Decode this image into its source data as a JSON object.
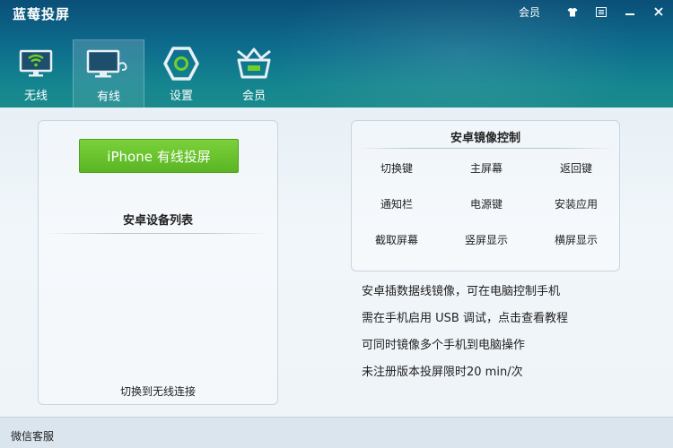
{
  "window": {
    "title": "蓝莓投屏",
    "member_label": "会员"
  },
  "tabs": [
    {
      "label": "无线",
      "icon": "wifi-monitor-icon"
    },
    {
      "label": "有线",
      "icon": "wired-monitor-icon",
      "active": true
    },
    {
      "label": "设置",
      "icon": "settings-hexagon-icon"
    },
    {
      "label": "会员",
      "icon": "crown-basket-icon"
    }
  ],
  "left": {
    "iphone_button": "iPhone 有线投屏",
    "device_list_title": "安卓设备列表",
    "switch_link": "切换到无线连接"
  },
  "mirror": {
    "title": "安卓镜像控制",
    "controls": [
      "切换键",
      "主屏幕",
      "返回键",
      "通知栏",
      "电源键",
      "安装应用",
      "截取屏幕",
      "竖屏显示",
      "横屏显示"
    ]
  },
  "tips": [
    "安卓插数据线镜像，可在电脑控制手机",
    "需在手机启用 USB 调试，点击查看教程",
    "可同时镜像多个手机到电脑操作",
    "未注册版本投屏限时20 min/次"
  ],
  "footer": {
    "wechat": "微信客服"
  },
  "colors": {
    "header": "#0d6d8d",
    "green_button": "#5ab524",
    "panel_border": "#c9d6df"
  }
}
